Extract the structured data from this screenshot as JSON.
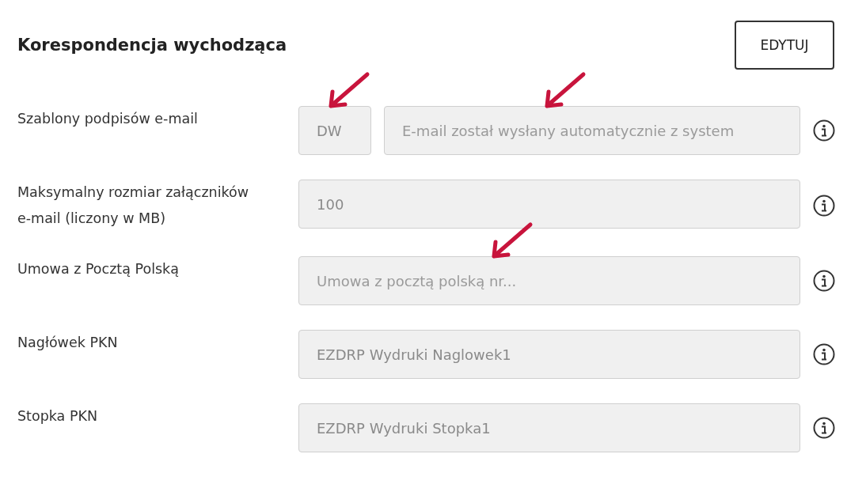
{
  "section": {
    "title": "Korespondencja wychodząca",
    "edit_button": "EDYTUJ"
  },
  "rows": [
    {
      "label": "Szablony podpisów e-mail",
      "fields": [
        {
          "kind": "short",
          "value": "DW",
          "arrow": true
        },
        {
          "kind": "wide",
          "placeholder": "E-mail został wysłany automatycznie z system",
          "arrow": true
        }
      ]
    },
    {
      "label": "Maksymalny rozmiar załączników e-mail (liczony w MB)",
      "fields": [
        {
          "kind": "wide",
          "value": "100",
          "arrow": false
        }
      ]
    },
    {
      "label": "Umowa z Pocztą Polską",
      "fields": [
        {
          "kind": "wide",
          "placeholder": "Umowa z pocztą polską nr...",
          "arrow": true
        }
      ]
    },
    {
      "label": "Nagłówek PKN",
      "fields": [
        {
          "kind": "wide",
          "value": "EZDRP Wydruki Naglowek1",
          "arrow": false
        }
      ]
    },
    {
      "label": "Stopka PKN",
      "fields": [
        {
          "kind": "wide",
          "value": "EZDRP Wydruki Stopka1",
          "arrow": false
        }
      ]
    }
  ]
}
